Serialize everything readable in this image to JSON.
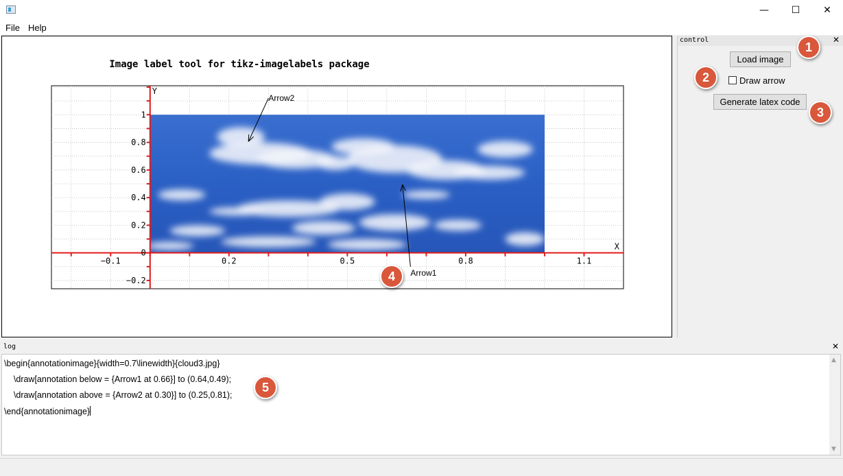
{
  "window": {
    "title": "",
    "minimize_glyph": "—",
    "maximize_glyph": "☐",
    "close_glyph": "✕"
  },
  "menu": {
    "file": "File",
    "help": "Help"
  },
  "control_dock": {
    "title": "control",
    "close_glyph": "✕",
    "load_image": "Load image",
    "draw_arrow": "Draw arrow",
    "draw_arrow_checked": false,
    "generate_code": "Generate latex code"
  },
  "log_dock": {
    "title": "log",
    "close_glyph": "✕",
    "lines": [
      "\\begin{annotationimage}{width=0.7\\linewidth}{cloud3.jpg}",
      "    \\draw[annotation below = {Arrow1 at 0.66}] to (0.64,0.49);",
      "    \\draw[annotation above = {Arrow2 at 0.30}] to (0.25,0.81);",
      "\\end{annotationimage}"
    ]
  },
  "badges": [
    "1",
    "2",
    "3",
    "4",
    "5"
  ],
  "colors": {
    "axis": "#e01b1b",
    "badge": "#d9573b",
    "sky": "#2a5fc4"
  },
  "chart_data": {
    "type": "scatter",
    "title": "Image label tool for tikz-imagelabels package",
    "xlabel": "X",
    "ylabel": "Y",
    "xlim": [
      -0.25,
      1.2
    ],
    "ylim": [
      -0.26,
      1.21
    ],
    "x_ticks": [
      {
        "value": -0.1,
        "label": "−0.1"
      },
      {
        "value": 0.2,
        "label": "0.2"
      },
      {
        "value": 0.5,
        "label": "0.5"
      },
      {
        "value": 0.8,
        "label": "0.8"
      },
      {
        "value": 1.1,
        "label": "1.1"
      }
    ],
    "y_ticks": [
      {
        "value": -0.2,
        "label": "−0.2"
      },
      {
        "value": 0,
        "label": "0"
      },
      {
        "value": 0.2,
        "label": "0.2"
      },
      {
        "value": 0.4,
        "label": "0.4"
      },
      {
        "value": 0.6,
        "label": "0.6"
      },
      {
        "value": 0.8,
        "label": "0.8"
      },
      {
        "value": 1,
        "label": "1"
      }
    ],
    "grid": true,
    "image_extent": {
      "x": [
        0,
        1
      ],
      "y": [
        0,
        1
      ]
    },
    "annotations": [
      {
        "label": "Arrow1",
        "target": [
          0.64,
          0.49
        ],
        "label_at": [
          0.66,
          -0.1
        ]
      },
      {
        "label": "Arrow2",
        "target": [
          0.25,
          0.81
        ],
        "label_at": [
          0.3,
          1.12
        ]
      }
    ]
  }
}
